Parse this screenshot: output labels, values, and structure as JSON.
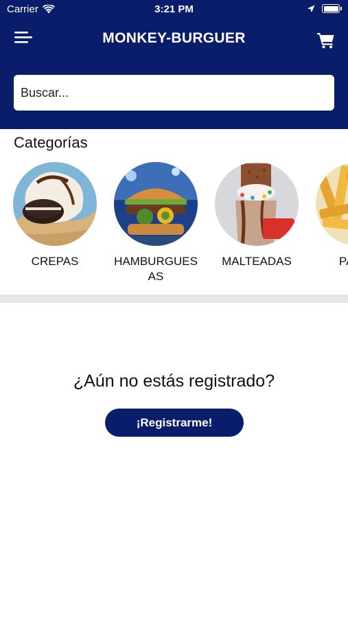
{
  "status_bar": {
    "carrier": "Carrier",
    "time": "3:21 PM"
  },
  "header": {
    "title": "MONKEY-BURGUER"
  },
  "search": {
    "placeholder": "Buscar..."
  },
  "categories": {
    "title": "Categorías",
    "items": [
      {
        "label": "CREPAS"
      },
      {
        "label": "HAMBURGUESAS"
      },
      {
        "label": "MALTEADAS"
      },
      {
        "label": "PAPAS"
      }
    ]
  },
  "register": {
    "question": "¿Aún no estás registrado?",
    "button_label": "¡Registrarme!"
  },
  "colors": {
    "primary": "#0a1d6b",
    "divider": "#e6e6e6",
    "background": "#ffffff"
  }
}
